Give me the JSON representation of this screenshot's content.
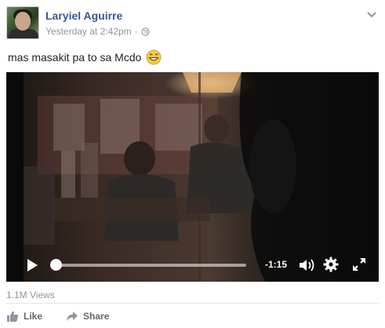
{
  "post": {
    "author": "Laryiel Aguirre",
    "timestamp": "Yesterday at 2:42pm",
    "separator": "·",
    "privacy_icon": "globe-icon",
    "text": "mas masakit pa to sa Mcdo",
    "emoji": "grinning-sweat-emoji"
  },
  "video": {
    "time_remaining": "-1:15",
    "progress": 0.0,
    "icons": [
      "play-icon",
      "volume-icon",
      "gear-icon",
      "fullscreen-icon"
    ]
  },
  "footer": {
    "views": "1.1M Views",
    "like_label": "Like",
    "share_label": "Share"
  },
  "colors": {
    "author_link": "#365899",
    "meta_text": "#90949c",
    "action_text": "#616770"
  }
}
